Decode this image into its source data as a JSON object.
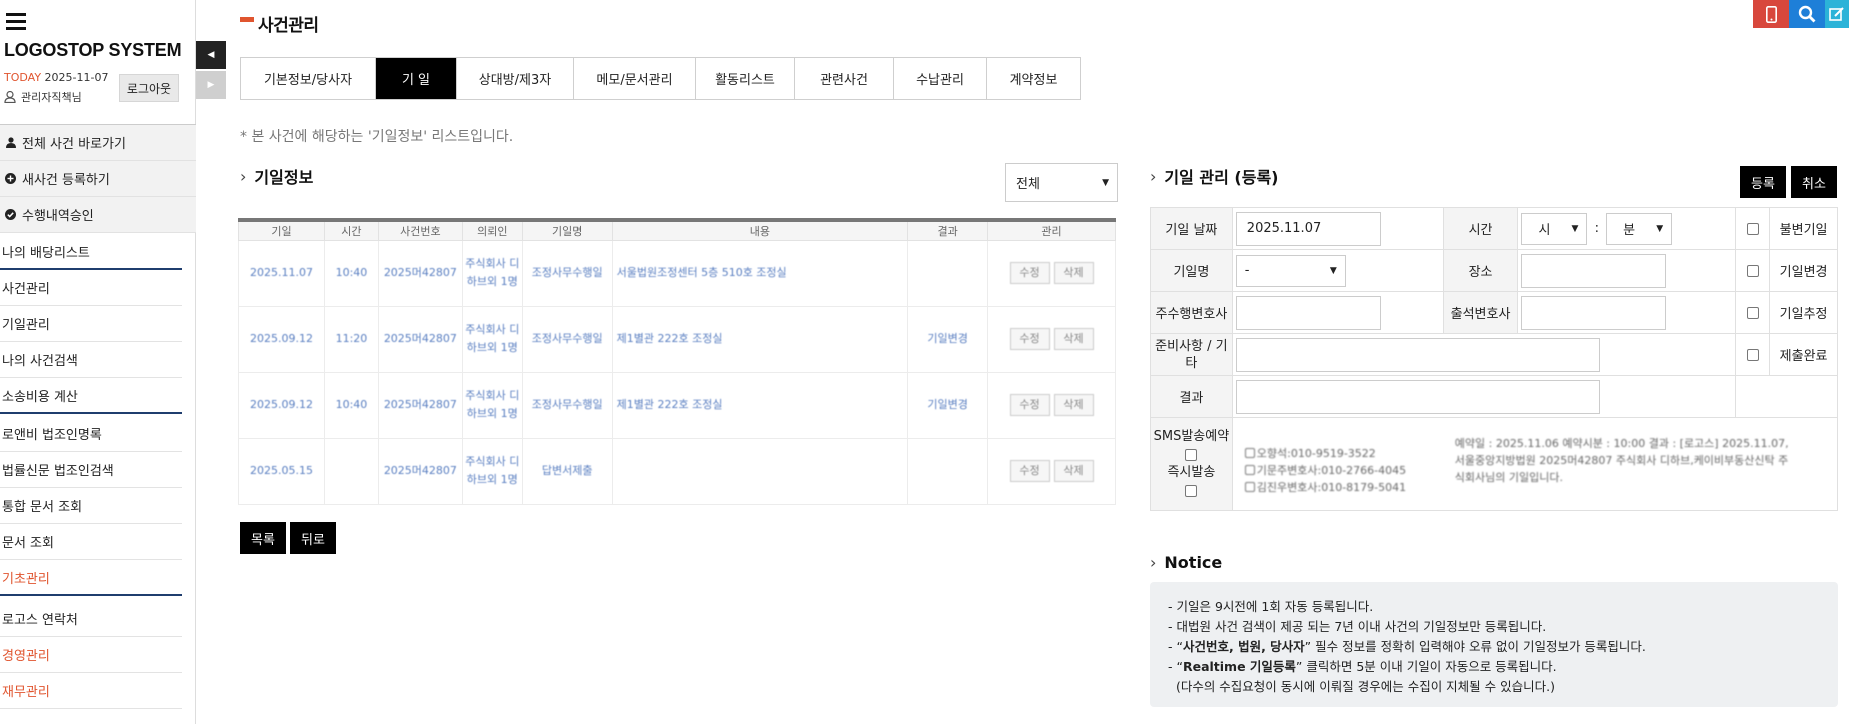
{
  "app": {
    "logo": "LOGOSTOP SYSTEM",
    "today_label": "TODAY",
    "today_date": "2025-11-07",
    "user_name": "관리자직책님",
    "logout_label": "로그아웃"
  },
  "sidebar": {
    "quick_links": [
      {
        "label": "전체 사건 바로가기",
        "icon": "user-icon"
      },
      {
        "label": "새사건 등록하기",
        "icon": "plus-circle-icon"
      },
      {
        "label": "수행내역승인",
        "icon": "check-circle-icon"
      }
    ],
    "menu": [
      {
        "label": "나의 배당리스트"
      },
      {
        "label": "사건관리"
      },
      {
        "label": "기일관리"
      },
      {
        "label": "나의 사건검색"
      },
      {
        "label": "소송비용 계산"
      },
      {
        "label": "로앤비 법조인명록"
      },
      {
        "label": "법률신문 법조인검색"
      },
      {
        "label": "통합 문서 조회"
      },
      {
        "label": "문서 조회"
      },
      {
        "label": "기초관리"
      },
      {
        "label": "로고스 연락처"
      },
      {
        "label": "경영관리"
      },
      {
        "label": "재무관리"
      }
    ],
    "toggle_icons": [
      "collapse-left-icon",
      "expand-right-icon"
    ]
  },
  "page": {
    "title": "사건관리",
    "tabs": [
      "기본정보/당사자",
      "기 일",
      "상대방/제3자",
      "메모/문서관리",
      "활동리스트",
      "관련사건",
      "수납관리",
      "계약정보"
    ],
    "active_tab": 1,
    "note": "* 본 사건에 해당하는 '기일정보' 리스트입니다."
  },
  "colors": {
    "accent": "#e0552f",
    "nav_separator": "#1f3d6e",
    "link_blue": "#5a7fc1",
    "top_btn_red": "#d8473c",
    "top_btn_blue": "#1e7fd8",
    "top_btn_cyan": "#2bb3d8"
  },
  "top_buttons": [
    {
      "name": "mobile-icon"
    },
    {
      "name": "search-icon"
    },
    {
      "name": "edit-icon"
    }
  ],
  "date_info": {
    "title": "기일정보",
    "filter_value": "전체",
    "columns": [
      "기일",
      "시간",
      "사건번호",
      "의뢰인",
      "기일명",
      "내용",
      "결과",
      "관리"
    ],
    "rows": [
      {
        "date": "2025.11.07",
        "time": "10:40",
        "case_no": "2025머42807",
        "client": "주식회사 디하브외 1명",
        "name": "조정사무수행일",
        "content": "서울법원조정센터 5층 510호 조정실",
        "result": "",
        "edit": "수정",
        "delete": "삭제"
      },
      {
        "date": "2025.09.12",
        "time": "11:20",
        "case_no": "2025머42807",
        "client": "주식회사 디하브외 1명",
        "name": "조정사무수행일",
        "content": "제1별관 222호 조정실",
        "result": "기일변경",
        "edit": "수정",
        "delete": "삭제"
      },
      {
        "date": "2025.09.12",
        "time": "10:40",
        "case_no": "2025머42807",
        "client": "주식회사 디하브외 1명",
        "name": "조정사무수행일",
        "content": "제1별관 222호 조정실",
        "result": "기일변경",
        "edit": "수정",
        "delete": "삭제"
      },
      {
        "date": "2025.05.15",
        "time": "",
        "case_no": "2025머42807",
        "client": "주식회사 디하브외 1명",
        "name": "답변서제출",
        "content": "",
        "result": "",
        "edit": "수정",
        "delete": "삭제"
      }
    ],
    "list_button": "목록",
    "back_button": "뒤로"
  },
  "registration": {
    "title": "기일 관리 (등록)",
    "register_button": "등록",
    "cancel_button": "취소",
    "date_label": "기일 날짜",
    "date_value": "2025.11.07",
    "time_label": "시간",
    "hour_value": "시",
    "time_sep": ":",
    "minute_value": "분",
    "name_label": "기일명",
    "name_value": "-",
    "place_label": "장소",
    "lawyer_label": "주수행변호사",
    "attend_label": "출석변호사",
    "prep_label": "준비사항 / 기타",
    "result_label": "결과",
    "sms_label": "SMS발송예약",
    "instant_label": "즉시발송",
    "checkboxes": [
      "불변기일",
      "기일변경",
      "기일추정",
      "제출완료"
    ],
    "sms_recipients": [
      "오향석:010-9519-3522",
      "기문주변호사:010-2766-4045",
      "김진우변호사:010-8179-5041"
    ],
    "sms_message": "예약일 : 2025.11.06   예약시분 : 10:00   결과 : [로고스] 2025.11.07, 서울중앙지방법원 2025머42807 주식회사 디하브,케이비부동산신탁 주식회사님의 기일입니다."
  },
  "notice": {
    "title": "Notice",
    "line1": "- 기일은 9시전에 1회 자동 등록됩니다.",
    "line2": "- 대법원 사건 검색이 제공 되는 7년 이내 사건의 기일정보만 등록됩니다.",
    "line3_pre": "- “",
    "line3_bold": "사건번호, 법원, 당사자",
    "line3_post": "” 필수 정보를 정확히 입력해야 오류 없이 기일정보가 등록됩니다.",
    "line4_pre": "- “",
    "line4_bold": "Realtime 기일등록",
    "line4_post": "” 클릭하면 5분 이내 기일이 자동으로 등록됩니다.",
    "line5": "  (다수의 수집요청이 동시에 이뤄질 경우에는 수집이 지체될 수 있습니다.)"
  }
}
